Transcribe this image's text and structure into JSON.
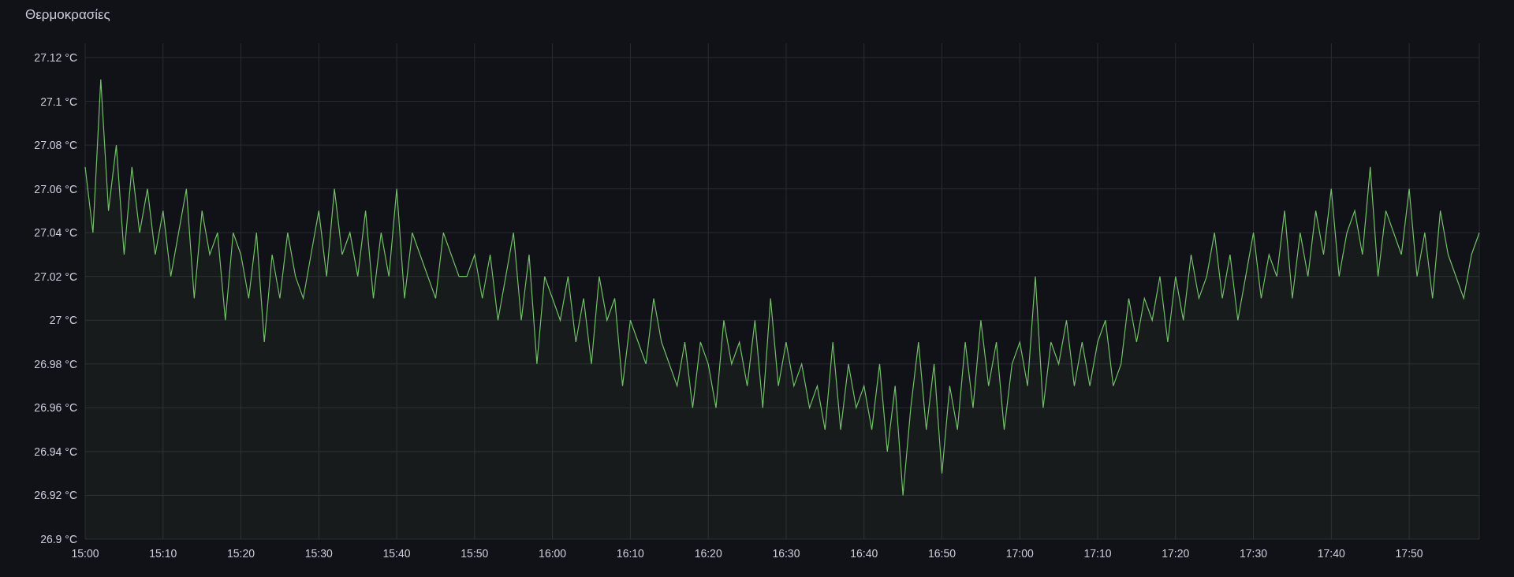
{
  "panel": {
    "chart_data": {
      "type": "area",
      "grid": true,
      "title": "Θερμοκρασίες",
      "categories": [
        "15:00",
        null,
        null,
        null,
        null,
        null,
        null,
        null,
        null,
        null,
        "15:10",
        null,
        null,
        null,
        null,
        null,
        null,
        null,
        null,
        null,
        "15:20",
        null,
        null,
        null,
        null,
        null,
        null,
        null,
        null,
        null,
        "15:30",
        null,
        null,
        null,
        null,
        null,
        null,
        null,
        null,
        null,
        "15:40",
        null,
        null,
        null,
        null,
        null,
        null,
        null,
        null,
        null,
        "15:50",
        null,
        null,
        null,
        null,
        null,
        null,
        null,
        null,
        null,
        "16:00",
        null,
        null,
        null,
        null,
        null,
        null,
        null,
        null,
        null,
        "16:10",
        null,
        null,
        null,
        null,
        null,
        null,
        null,
        null,
        null,
        "16:20",
        null,
        null,
        null,
        null,
        null,
        null,
        null,
        null,
        null,
        "16:30",
        null,
        null,
        null,
        null,
        null,
        null,
        null,
        null,
        null,
        "16:40",
        null,
        null,
        null,
        null,
        null,
        null,
        null,
        null,
        null,
        "16:50",
        null,
        null,
        null,
        null,
        null,
        null,
        null,
        null,
        null,
        "17:00",
        null,
        null,
        null,
        null,
        null,
        null,
        null,
        null,
        null,
        "17:10",
        null,
        null,
        null,
        null,
        null,
        null,
        null,
        null,
        null,
        "17:20",
        null,
        null,
        null,
        null,
        null,
        null,
        null,
        null,
        null,
        "17:30",
        null,
        null,
        null,
        null,
        null,
        null,
        null,
        null,
        null,
        "17:40",
        null,
        null,
        null,
        null,
        null,
        null,
        null,
        null,
        null,
        "17:50",
        null,
        null,
        null,
        null,
        null,
        null,
        null,
        null,
        null
      ],
      "series": [
        {
          "color": "#73bf69",
          "values": [
            27.07,
            27.04,
            27.11,
            27.05,
            27.08,
            27.03,
            27.07,
            27.04,
            27.06,
            27.03,
            27.05,
            27.02,
            27.04,
            27.06,
            27.01,
            27.05,
            27.03,
            27.04,
            27.0,
            27.04,
            27.03,
            27.01,
            27.04,
            26.99,
            27.03,
            27.01,
            27.04,
            27.02,
            27.01,
            27.03,
            27.05,
            27.02,
            27.06,
            27.03,
            27.04,
            27.02,
            27.05,
            27.01,
            27.04,
            27.02,
            27.06,
            27.01,
            27.04,
            27.03,
            27.02,
            27.01,
            27.04,
            27.03,
            27.02,
            27.02,
            27.03,
            27.01,
            27.03,
            27.0,
            27.02,
            27.04,
            27.0,
            27.03,
            26.98,
            27.02,
            27.01,
            27.0,
            27.02,
            26.99,
            27.01,
            26.98,
            27.02,
            27.0,
            27.01,
            26.97,
            27.0,
            26.99,
            26.98,
            27.01,
            26.99,
            26.98,
            26.97,
            26.99,
            26.96,
            26.99,
            26.98,
            26.96,
            27.0,
            26.98,
            26.99,
            26.97,
            27.0,
            26.96,
            27.01,
            26.97,
            26.99,
            26.97,
            26.98,
            26.96,
            26.97,
            26.95,
            26.99,
            26.95,
            26.98,
            26.96,
            26.97,
            26.95,
            26.98,
            26.94,
            26.97,
            26.92,
            26.96,
            26.99,
            26.95,
            26.98,
            26.93,
            26.97,
            26.95,
            26.99,
            26.96,
            27.0,
            26.97,
            26.99,
            26.95,
            26.98,
            26.99,
            26.97,
            27.02,
            26.96,
            26.99,
            26.98,
            27.0,
            26.97,
            26.99,
            26.97,
            26.99,
            27.0,
            26.97,
            26.98,
            27.01,
            26.99,
            27.01,
            27.0,
            27.02,
            26.99,
            27.02,
            27.0,
            27.03,
            27.01,
            27.02,
            27.04,
            27.01,
            27.03,
            27.0,
            27.02,
            27.04,
            27.01,
            27.03,
            27.02,
            27.05,
            27.01,
            27.04,
            27.02,
            27.05,
            27.03,
            27.06,
            27.02,
            27.04,
            27.05,
            27.03,
            27.07,
            27.02,
            27.05,
            27.04,
            27.03,
            27.06,
            27.02,
            27.04,
            27.01,
            27.05,
            27.03,
            27.02,
            27.01,
            27.03,
            27.04
          ]
        }
      ],
      "ylim": [
        26.9,
        27.12
      ],
      "yticks": [
        {
          "value": 26.9,
          "label": "26.9 °C"
        },
        {
          "value": 26.92,
          "label": "26.92 °C"
        },
        {
          "value": 26.94,
          "label": "26.94 °C"
        },
        {
          "value": 26.96,
          "label": "26.96 °C"
        },
        {
          "value": 26.98,
          "label": "26.98 °C"
        },
        {
          "value": 27,
          "label": "27 °C"
        },
        {
          "value": 27.02,
          "label": "27.02 °C"
        },
        {
          "value": 27.04,
          "label": "27.04 °C"
        },
        {
          "value": 27.06,
          "label": "27.06 °C"
        },
        {
          "value": 27.08,
          "label": "27.08 °C"
        },
        {
          "value": 27.1,
          "label": "27.1 °C"
        },
        {
          "value": 27.12,
          "label": "27.12 °C"
        }
      ]
    }
  }
}
